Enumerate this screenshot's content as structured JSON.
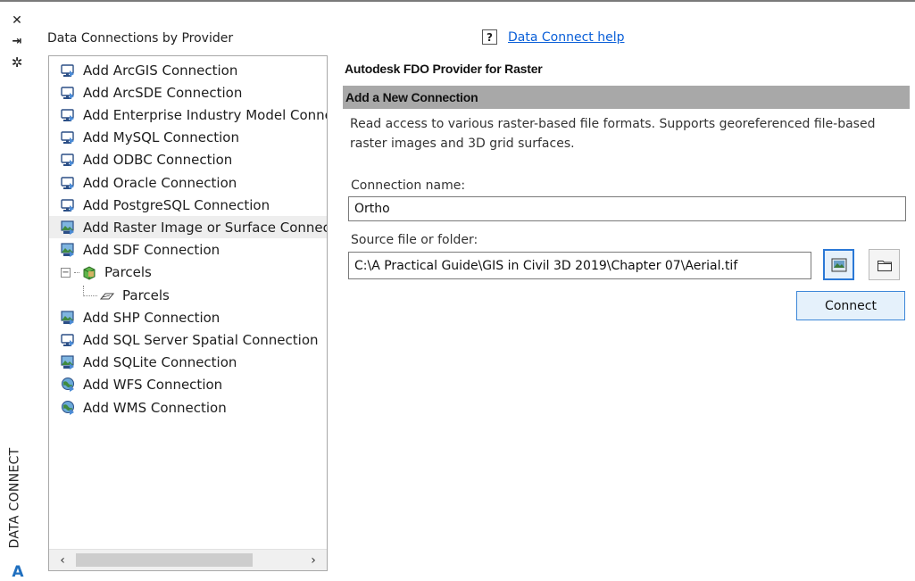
{
  "strip": {
    "title": "DATA CONNECT",
    "close_glyph": "✕",
    "pin_glyph": "⇥",
    "settings_glyph": "✲",
    "logo_glyph": "A"
  },
  "tree": {
    "header": "Data Connections by Provider",
    "items": [
      {
        "label": "Add ArcGIS Connection",
        "icon": "connection-icon",
        "indent": 0
      },
      {
        "label": "Add ArcSDE Connection",
        "icon": "connection-icon",
        "indent": 0
      },
      {
        "label": "Add Enterprise Industry Model Connection",
        "icon": "connection-icon",
        "indent": 0
      },
      {
        "label": "Add MySQL Connection",
        "icon": "connection-icon",
        "indent": 0
      },
      {
        "label": "Add ODBC Connection",
        "icon": "connection-icon",
        "indent": 0
      },
      {
        "label": "Add Oracle Connection",
        "icon": "connection-icon",
        "indent": 0
      },
      {
        "label": "Add PostgreSQL Connection",
        "icon": "connection-icon",
        "indent": 0
      },
      {
        "label": "Add Raster Image or Surface Connection",
        "icon": "raster-connection-icon",
        "indent": 0
      },
      {
        "label": "Add SDF Connection",
        "icon": "raster-connection-icon",
        "indent": 0
      },
      {
        "label": "Parcels",
        "icon": "cube-icon",
        "indent": 1
      },
      {
        "label": "Parcels",
        "icon": "polygon-icon",
        "indent": 2
      },
      {
        "label": "Add SHP Connection",
        "icon": "raster-connection-icon",
        "indent": 0
      },
      {
        "label": "Add SQL Server Spatial Connection",
        "icon": "connection-icon",
        "indent": 0
      },
      {
        "label": "Add SQLite Connection",
        "icon": "raster-connection-icon",
        "indent": 0
      },
      {
        "label": "Add WFS Connection",
        "icon": "globe-icon",
        "indent": 0
      },
      {
        "label": "Add WMS Connection",
        "icon": "globe-icon",
        "indent": 0
      }
    ],
    "scroll_left": "‹",
    "scroll_right": "›"
  },
  "panel": {
    "help_box": "?",
    "help_link": "Data Connect help",
    "provider_title": "Autodesk FDO Provider for Raster",
    "section_title": "Add a New Connection",
    "description": "Read access to various raster-based file formats.  Supports georeferenced file-based raster images and 3D grid surfaces.",
    "connection_name_label": "Connection name:",
    "connection_name_value": "Ortho",
    "source_label": "Source file or folder:",
    "source_value": "C:\\A Practical Guide\\GIS in Civil 3D 2019\\Chapter 07\\Aerial.tif",
    "connect_label": "Connect"
  },
  "colors": {
    "accent": "#2a78d6",
    "section_bar": "#a8a8a8",
    "link": "#0a5fd8"
  }
}
